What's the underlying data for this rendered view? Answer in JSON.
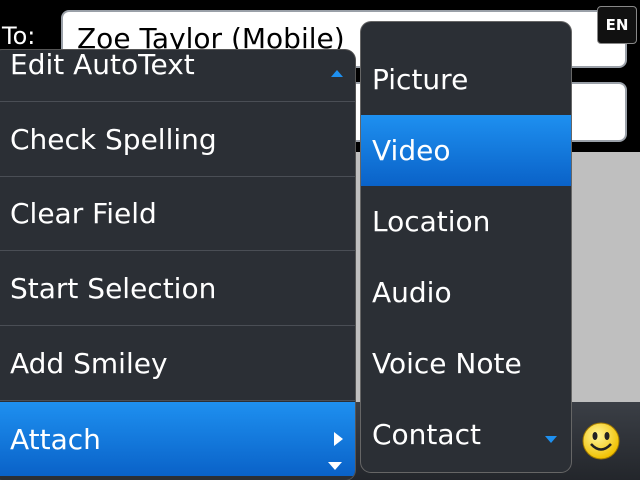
{
  "compose": {
    "to_label": "To:",
    "to_value": "Zoe Taylor (Mobile)",
    "subject_value": ""
  },
  "status": {
    "input_language": "EN"
  },
  "menu": {
    "items": [
      {
        "label": "Edit AutoText"
      },
      {
        "label": "Check Spelling"
      },
      {
        "label": "Clear Field"
      },
      {
        "label": "Start Selection"
      },
      {
        "label": "Add Smiley"
      },
      {
        "label": "Attach"
      }
    ],
    "selected": "Attach"
  },
  "submenu": {
    "items": [
      {
        "label": "Picture"
      },
      {
        "label": "Video"
      },
      {
        "label": "Location"
      },
      {
        "label": "Audio"
      },
      {
        "label": "Voice Note"
      },
      {
        "label": "Contact"
      }
    ],
    "selected": "Video"
  },
  "colors": {
    "highlight": "#1e90f0",
    "menu_bg": "#2b2f35"
  },
  "icons": {
    "smiley": "smiley-face-icon"
  }
}
